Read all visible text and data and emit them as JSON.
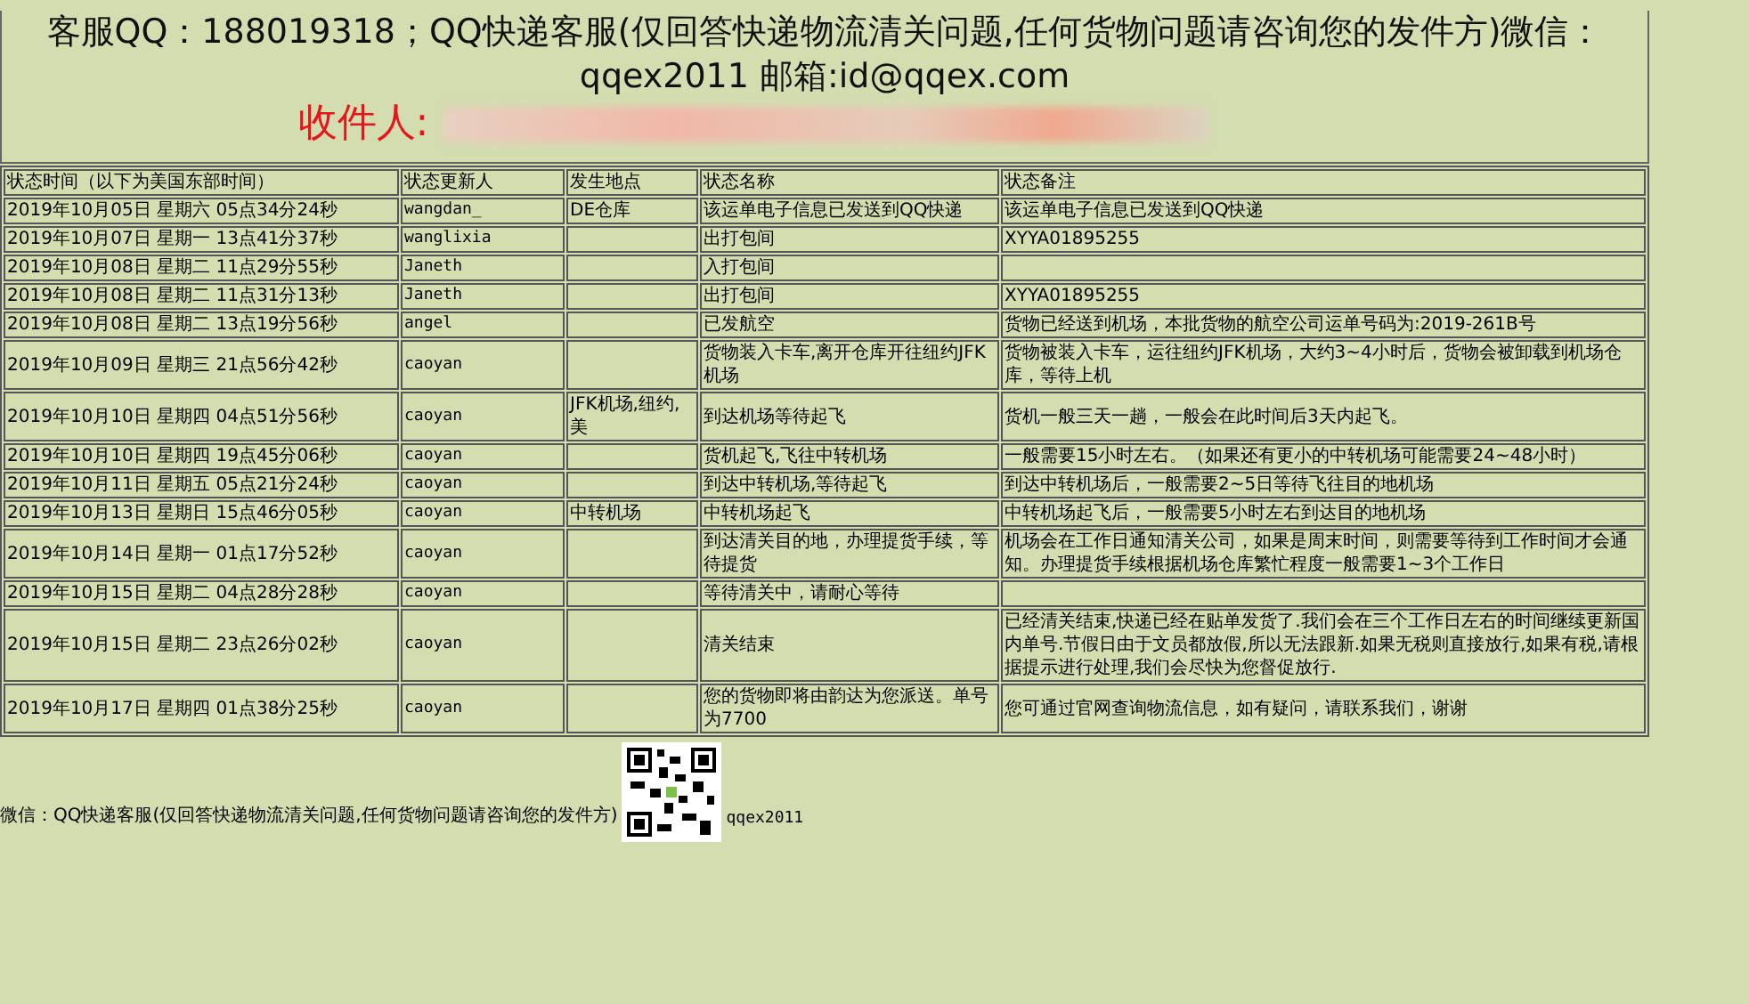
{
  "contact": {
    "line": "客服QQ：188019318；QQ快递客服(仅回答快递物流清关问题,任何货物问题请咨询您的发件方)微信：qqex2011 邮箱:id@qqex.com",
    "recipient_label": "收件人:"
  },
  "table": {
    "columns": [
      "状态时间（以下为美国东部时间）",
      "状态更新人",
      "发生地点",
      "状态名称",
      "状态备注"
    ],
    "rows": [
      [
        "2019年10月05日 星期六 05点34分24秒",
        "wangdan_",
        "DE仓库",
        "该运单电子信息已发送到QQ快递",
        "该运单电子信息已发送到QQ快递"
      ],
      [
        "2019年10月07日 星期一 13点41分37秒",
        "wanglixia",
        "",
        "出打包间",
        "XYYA01895255"
      ],
      [
        "2019年10月08日 星期二 11点29分55秒",
        "Janeth",
        "",
        "入打包间",
        ""
      ],
      [
        "2019年10月08日 星期二 11点31分13秒",
        "Janeth",
        "",
        "出打包间",
        "XYYA01895255"
      ],
      [
        "2019年10月08日 星期二 13点19分56秒",
        "angel",
        "",
        "已发航空",
        "货物已经送到机场，本批货物的航空公司运单号码为:2019-261B号"
      ],
      [
        "2019年10月09日 星期三 21点56分42秒",
        "caoyan",
        "",
        "货物装入卡车,离开仓库开往纽约JFK机场",
        "货物被装入卡车，运往纽约JFK机场，大约3~4小时后，货物会被卸载到机场仓库，等待上机"
      ],
      [
        "2019年10月10日 星期四 04点51分56秒",
        "caoyan",
        "JFK机场,纽约,美",
        "到达机场等待起飞",
        "货机一般三天一趟，一般会在此时间后3天内起飞。"
      ],
      [
        "2019年10月10日 星期四 19点45分06秒",
        "caoyan",
        "",
        "货机起飞,飞往中转机场",
        "一般需要15小时左右。（如果还有更小的中转机场可能需要24~48小时）"
      ],
      [
        "2019年10月11日 星期五 05点21分24秒",
        "caoyan",
        "",
        "到达中转机场,等待起飞",
        "到达中转机场后，一般需要2~5日等待飞往目的地机场"
      ],
      [
        "2019年10月13日 星期日 15点46分05秒",
        "caoyan",
        "中转机场",
        "中转机场起飞",
        "中转机场起飞后，一般需要5小时左右到达目的地机场"
      ],
      [
        "2019年10月14日 星期一 01点17分52秒",
        "caoyan",
        "",
        "到达清关目的地，办理提货手续，等待提货",
        "机场会在工作日通知清关公司，如果是周末时间，则需要等待到工作时间才会通知。办理提货手续根据机场仓库繁忙程度一般需要1~3个工作日"
      ],
      [
        "2019年10月15日 星期二 04点28分28秒",
        "caoyan",
        "",
        "等待清关中，请耐心等待",
        ""
      ],
      [
        "2019年10月15日 星期二 23点26分02秒",
        "caoyan",
        "",
        "清关结束",
        "已经清关结束,快递已经在贴单发货了.我们会在三个工作日左右的时间继续更新国内单号.节假日由于文员都放假,所以无法跟新.如果无税则直接放行,如果有税,请根据提示进行处理,我们会尽快为您督促放行."
      ],
      [
        "2019年10月17日 星期四 01点38分25秒",
        "caoyan",
        "",
        "您的货物即将由韵达为您派送。单号为7700",
        "您可通过官网查询物流信息，如有疑问，请联系我们，谢谢"
      ]
    ]
  },
  "footer": {
    "wechat_text": "微信：QQ快递客服(仅回答快递物流清关问题,任何货物问题请咨询您的发件方)",
    "wechat_id": "qqex2011"
  }
}
